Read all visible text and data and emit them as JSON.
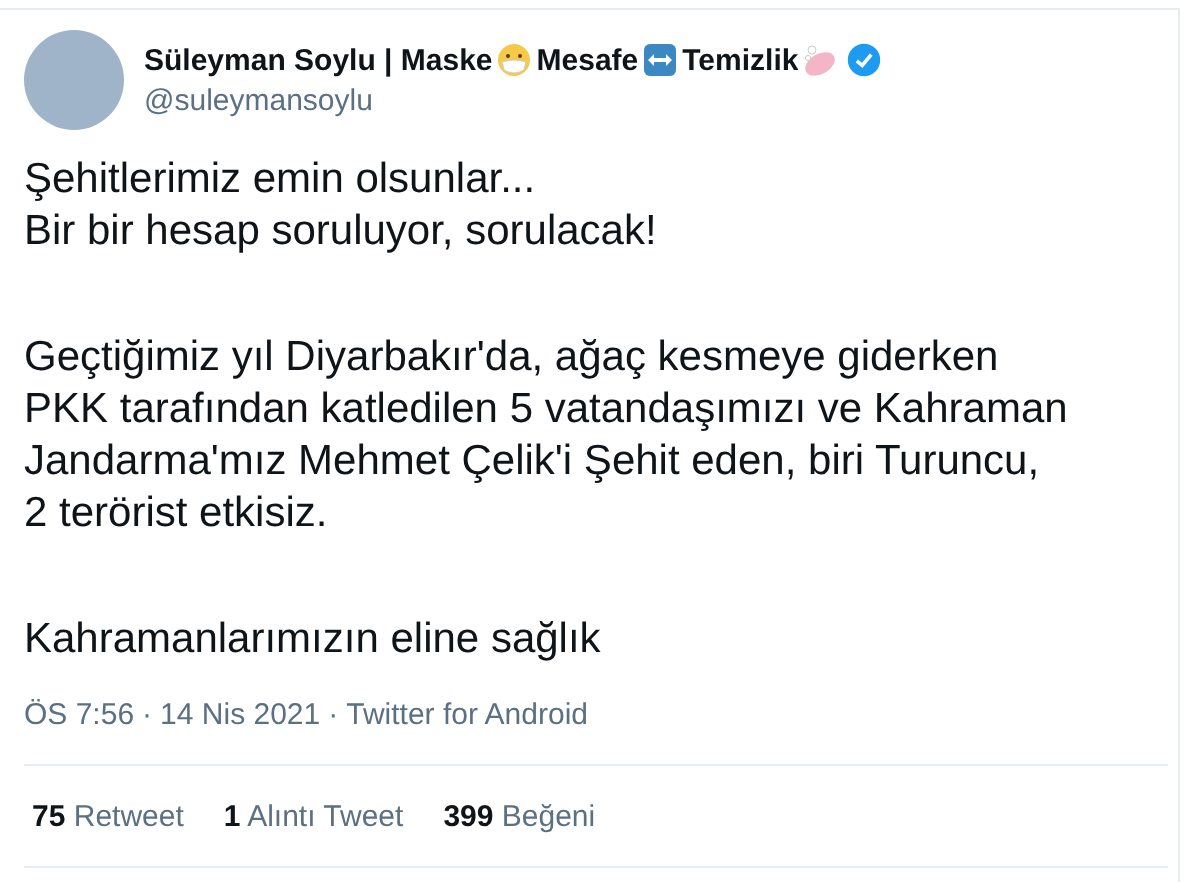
{
  "author": {
    "name_segments": [
      "Süleyman Soylu | Maske",
      "Mesafe",
      "Temizlik"
    ],
    "verified": true,
    "handle": "@suleymansoylu"
  },
  "body": [
    [
      "Şehitlerimiz emin olsunlar...",
      "Bir bir hesap soruluyor, sorulacak!"
    ],
    [
      "Geçtiğimiz yıl Diyarbakır'da, ağaç kesmeye giderken",
      "PKK tarafından katledilen 5 vatandaşımızı ve Kahraman",
      "Jandarma'mız Mehmet Çelik'i Şehit eden, biri Turuncu,",
      "2 terörist etkisiz."
    ],
    [
      "Kahramanlarımızın eline sağlık"
    ]
  ],
  "meta": [
    "ÖS 7:56",
    "·",
    "14 Nis 2021",
    "·",
    "Twitter for Android"
  ],
  "stats": [
    "**75** Retweet",
    "**1** Alıntı Tweet",
    "**399** Beğeni"
  ]
}
